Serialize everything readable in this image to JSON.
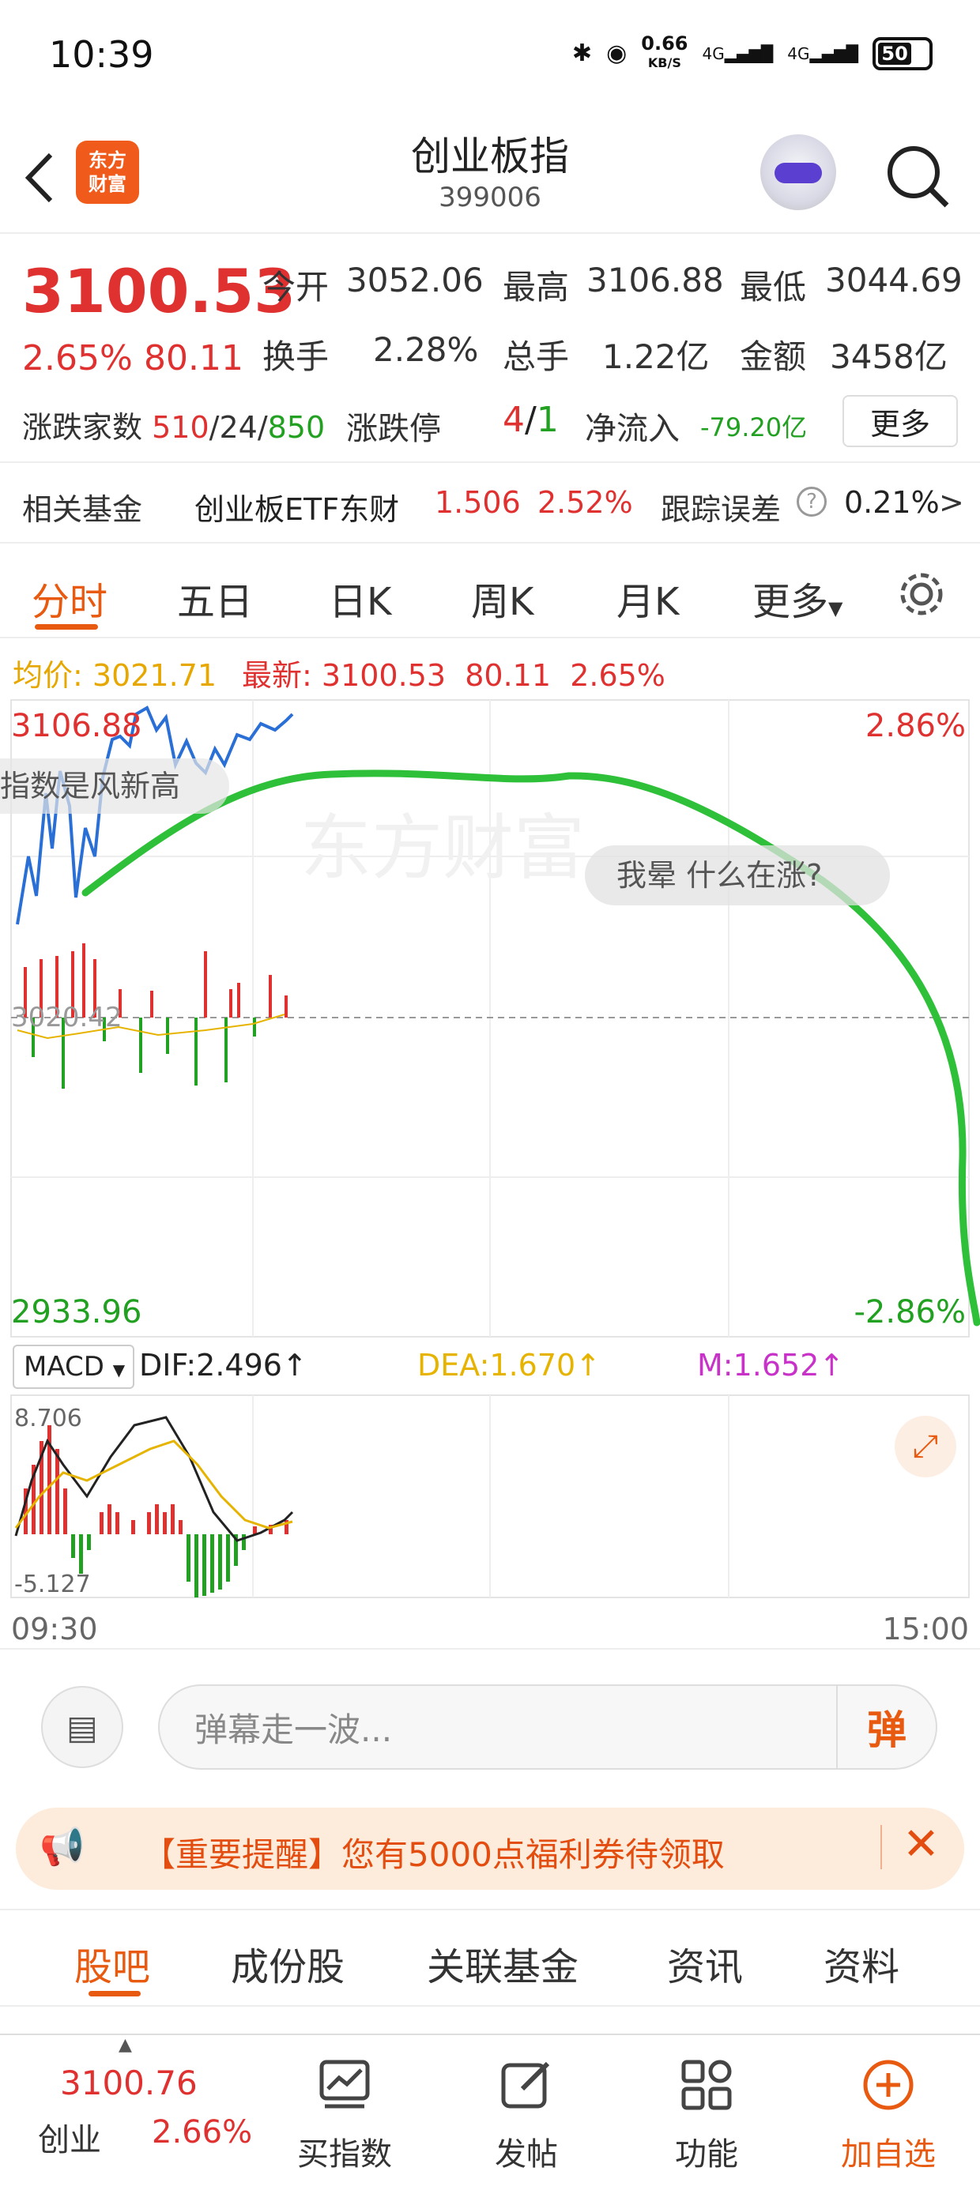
{
  "status_bar": {
    "time": "10:39",
    "net_speed": "0.66",
    "net_unit": "KB/S",
    "signal1": "4G",
    "signal2": "4G",
    "battery": "50"
  },
  "header": {
    "logo_line1": "东方",
    "logo_line2": "财富",
    "title": "创业板指",
    "code": "399006"
  },
  "quote": {
    "price": "3100.53",
    "change_pct": "2.65%",
    "change": "80.11",
    "open_label": "今开",
    "open": "3052.06",
    "high_label": "最高",
    "high": "3106.88",
    "low_label": "最低",
    "low": "3044.69",
    "turnover_label": "换手",
    "turnover": "2.28%",
    "volume_label": "总手",
    "volume": "1.22亿",
    "amount_label": "金额",
    "amount": "3458亿",
    "breadth_label": "涨跌家数",
    "up": "510",
    "flat": "24",
    "down": "850",
    "limit_label": "涨跌停",
    "limit_up": "4",
    "limit_down": "1",
    "netflow_label": "净流入",
    "netflow": "-79.20亿",
    "more": "更多"
  },
  "fund": {
    "label": "相关基金",
    "name": "创业板ETF东财",
    "price": "1.506",
    "pct": "2.52%",
    "err_label": "跟踪误差",
    "err": "0.21%",
    "arrow": ">"
  },
  "tabs": [
    "分时",
    "五日",
    "日K",
    "周K",
    "月K",
    "更多"
  ],
  "avg_bar": {
    "avg_label": "均价:",
    "avg": "3021.71",
    "latest_label": "最新:",
    "latest": "3100.53",
    "change": "80.11",
    "pct": "2.65%"
  },
  "chart": {
    "y_top": "3106.88",
    "y_bottom": "2933.96",
    "pct_top": "2.86%",
    "pct_bottom": "-2.86%",
    "mid_label": "3020.42",
    "watermark": "东方财富",
    "bubble1": "指数是风新高",
    "bubble2": "我晕 什么在涨?",
    "macd_label": "MACD",
    "dif": "DIF:2.496↑",
    "dea": "DEA:1.670↑",
    "m": "M:1.652↑",
    "macd_top": "8.706",
    "macd_bottom": "-5.127",
    "x_start": "09:30",
    "x_end": "15:00"
  },
  "toolbar": {
    "placeholder": "弹幕走一波...",
    "danmu_btn": "弹"
  },
  "notice": {
    "text": "【重要提醒】您有5000点福利券待领取"
  },
  "subtabs": [
    "股吧",
    "成份股",
    "关联基金",
    "资讯",
    "资料"
  ],
  "bottom": {
    "price": "3100.76",
    "name": "创业",
    "pct": "2.66%",
    "buy": "买指数",
    "post": "发帖",
    "func": "功能",
    "add": "加自选"
  },
  "colors": {
    "up": "#e03131",
    "down": "#21a021",
    "accent": "#e85a10"
  }
}
